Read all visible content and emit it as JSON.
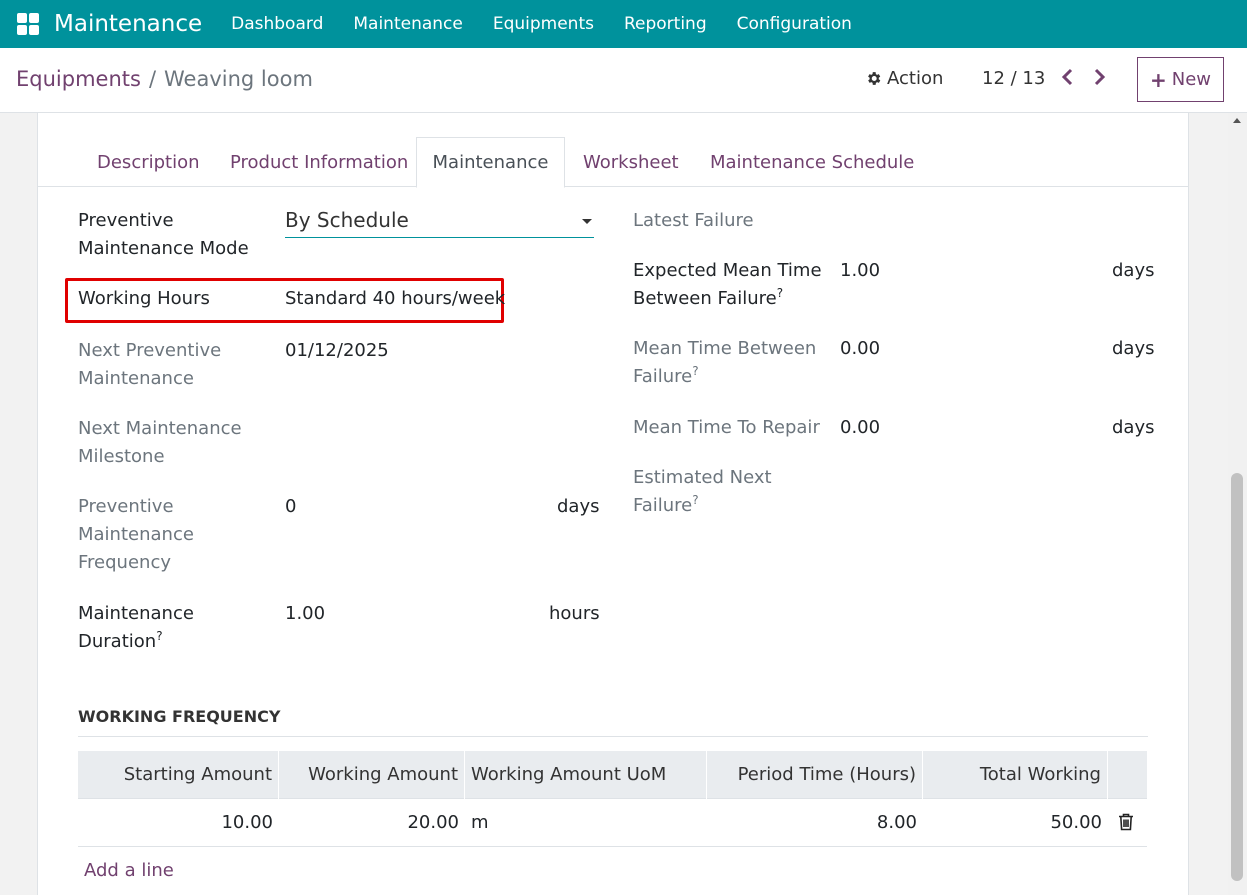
{
  "navbar": {
    "brand": "Maintenance",
    "items": [
      "Dashboard",
      "Maintenance",
      "Equipments",
      "Reporting",
      "Configuration"
    ]
  },
  "breadcrumb": {
    "parent": "Equipments",
    "separator": "/",
    "current": "Weaving loom"
  },
  "control": {
    "action_label": "Action",
    "pager": "12 / 13",
    "new_label": "New"
  },
  "tabs": [
    "Description",
    "Product Information",
    "Maintenance",
    "Worksheet",
    "Maintenance Schedule"
  ],
  "active_tab": "Maintenance",
  "left_fields": {
    "pm_mode": {
      "label_1": "Preventive",
      "label_2": "Maintenance Mode",
      "value": "By Schedule"
    },
    "working_hours": {
      "label": "Working Hours",
      "value": "Standard 40 hours/week"
    },
    "next_pm": {
      "label_1": "Next Preventive",
      "label_2": "Maintenance",
      "value": "01/12/2025"
    },
    "next_milestone": {
      "label_1": "Next Maintenance",
      "label_2": "Milestone",
      "value": ""
    },
    "pm_frequency": {
      "label_1": "Preventive",
      "label_2": "Maintenance",
      "label_3": "Frequency",
      "value": "0",
      "unit": "days"
    },
    "duration": {
      "label_1": "Maintenance",
      "label_2": "Duration",
      "help": "?",
      "value": "1.00",
      "unit": "hours"
    }
  },
  "right_fields": {
    "latest_failure": {
      "label": "Latest Failure",
      "value": ""
    },
    "expected_mtbf": {
      "label_1": "Expected Mean Time",
      "label_2": "Between Failure",
      "help": "?",
      "value": "1.00",
      "unit": "days"
    },
    "mtbf": {
      "label_1": "Mean Time Between",
      "label_2": "Failure",
      "help": "?",
      "value": "0.00",
      "unit": "days"
    },
    "mttr": {
      "label": "Mean Time To Repair",
      "value": "0.00",
      "unit": "days"
    },
    "est_next_failure": {
      "label_1": "Estimated Next",
      "label_2": "Failure",
      "help": "?",
      "value": ""
    }
  },
  "working_frequency": {
    "title": "WORKING FREQUENCY",
    "columns": [
      "Starting Amount",
      "Working Amount",
      "Working Amount UoM",
      "Period Time (Hours)",
      "Total Working"
    ],
    "rows": [
      {
        "starting_amount": "10.00",
        "working_amount": "20.00",
        "uom": "m",
        "period_time": "8.00",
        "total_working": "50.00"
      }
    ],
    "add_line": "Add a line"
  },
  "colors": {
    "navbar": "#00929c",
    "link": "#71416f",
    "highlight": "#e00000"
  },
  "icons": [
    "apps-icon",
    "gear-icon",
    "chevron-left-icon",
    "chevron-right-icon",
    "plus-icon",
    "trash-icon",
    "caret-down-icon"
  ]
}
